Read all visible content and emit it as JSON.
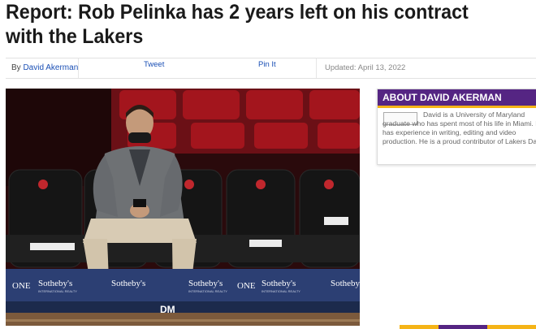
{
  "article": {
    "title": "Report: Rob Pelinka has 2 years left on his contract with the Lakers",
    "by_label": "By",
    "author": "David Akerman",
    "share": {
      "tweet": "Tweet",
      "pin": "Pin It"
    },
    "updated": "Updated: April 13, 2022"
  },
  "photo": {
    "ads": [
      "ONE",
      "Sotheby's",
      "INTERNATIONAL REALTY",
      "Sotheby",
      "DM"
    ]
  },
  "sidebar": {
    "heading": "ABOUT DAVID AKERMAN",
    "bio": "David is a University of Maryland graduate who has spent most of his life in Miami. He has experience in writing, editing and video production. He is a proud contributor of Lakers Daily."
  },
  "colors": {
    "accent": "#552583",
    "gold": "#f5b417",
    "link": "#1a4fb5"
  }
}
